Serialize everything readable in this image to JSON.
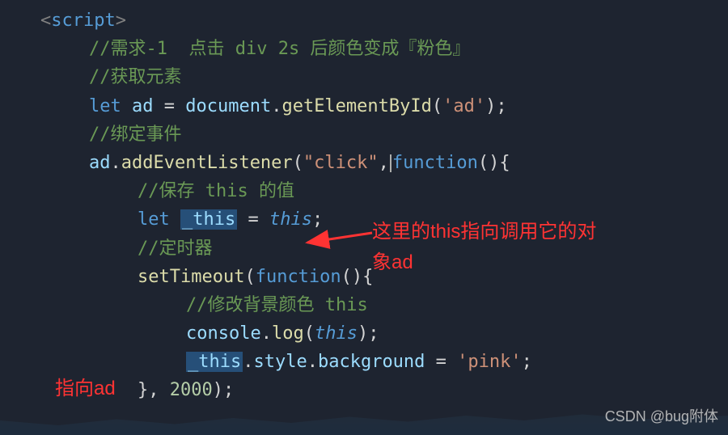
{
  "code": {
    "line1_open": "<",
    "line1_tag": "script",
    "line1_close": ">",
    "line2_comment": "//需求-1  点击 div 2s 后颜色变成『粉色』",
    "line3_comment": "//获取元素",
    "line4_let": "let",
    "line4_var": " ad ",
    "line4_eq": "= ",
    "line4_doc": "document",
    "line4_dot": ".",
    "line4_fn": "getElementById",
    "line4_paren": "(",
    "line4_str": "'ad'",
    "line4_end": ");",
    "line5_comment": "//绑定事件",
    "line6_var": "ad",
    "line6_dot": ".",
    "line6_fn": "addEventListener",
    "line6_paren": "(",
    "line6_str": "\"click\"",
    "line6_comma": ",",
    "line6_func": "function",
    "line6_paren2": "(){",
    "line7_comment": "//保存 this 的值",
    "line8_let": "let",
    "line8_space": " ",
    "line8_uthis": "_this",
    "line8_eq": " = ",
    "line8_this": "this",
    "line8_semi": ";",
    "line9_comment": "//定时器",
    "line10_fn": "setTimeout",
    "line10_paren": "(",
    "line10_func": "function",
    "line10_paren2": "(){",
    "line11_comment": "//修改背景颜色 this",
    "line12_console": "console",
    "line12_dot": ".",
    "line12_log": "log",
    "line12_paren": "(",
    "line12_this": "this",
    "line12_end": ");",
    "line13_uthis": "_this",
    "line13_dot1": ".",
    "line13_style": "style",
    "line13_dot2": ".",
    "line13_bg": "background",
    "line13_eq": " = ",
    "line13_str": "'pink'",
    "line13_semi": ";",
    "line14_close": "}, ",
    "line14_num": "2000",
    "line14_end": ");"
  },
  "annotations": {
    "right1": "这里的this指向调用它的对",
    "right2": "象ad",
    "left": "指向ad"
  },
  "watermark": "CSDN @bug附体"
}
